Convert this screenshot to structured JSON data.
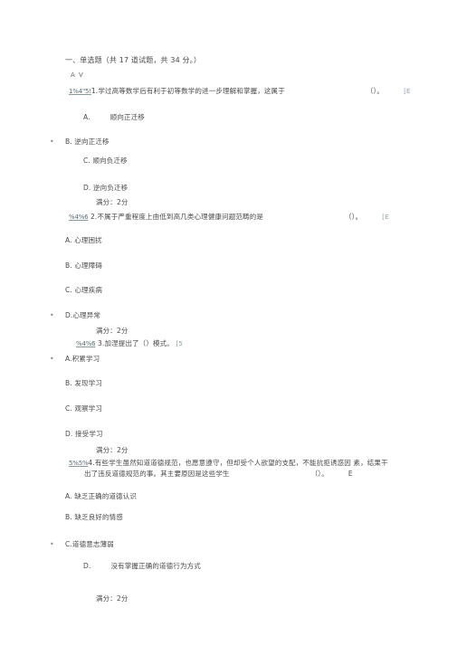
{
  "document": {
    "section_heading": "一、单选题（共 17 道试题，共 34 分。）",
    "small_marker": "A V",
    "full_score_label": "满分：2分",
    "blank_paren": "（）。",
    "cut_marker": "[E"
  },
  "questions": [
    {
      "id_prefix": "1%4\"5!",
      "number": "1.",
      "text": "学过高等数学后有利于初等数学的进一步理解和掌握，这属于",
      "blank": "（）。",
      "tail": "[E",
      "options": [
        {
          "letter": "A.",
          "label": "顺向正迁移",
          "bullet": false,
          "indent": "wide"
        },
        {
          "letter": "B.",
          "label": "逆向正迁移",
          "bullet": true,
          "indent": "narrow"
        },
        {
          "letter": "C.",
          "label": "顺向负迁移",
          "bullet": false,
          "indent": "normal"
        },
        {
          "letter": "D.",
          "label": "逆向负迁移",
          "bullet": false,
          "indent": "normal"
        }
      ],
      "score": "满分：2分"
    },
    {
      "id_prefix": "%4%6",
      "number": "2.",
      "text": "不属于严重程度上由低到高几类心理健康问题范畴的是",
      "blank": "（）。",
      "tail": "[E",
      "options": [
        {
          "letter": "A.",
          "label": "心理困扰",
          "bullet": false,
          "indent": "normal"
        },
        {
          "letter": "B.",
          "label": "心理障碍",
          "bullet": false,
          "indent": "normal"
        },
        {
          "letter": "C.",
          "label": "心理疾病",
          "bullet": false,
          "indent": "normal"
        },
        {
          "letter": "D.",
          "label": "心理异常",
          "bullet": true,
          "indent": "narrow"
        }
      ],
      "score": "满分：2分"
    },
    {
      "id_prefix": "%4%6",
      "number": "3.",
      "text": "加涅提出了（）模式。",
      "blank": "",
      "tail": "[5",
      "options": [
        {
          "letter": "A.",
          "label": "积累学习",
          "bullet": true,
          "indent": "narrow"
        },
        {
          "letter": "B.",
          "label": "发现学习",
          "bullet": false,
          "indent": "normal"
        },
        {
          "letter": "C.",
          "label": "观察学习",
          "bullet": false,
          "indent": "normal"
        },
        {
          "letter": "D.",
          "label": "接受学习",
          "bullet": false,
          "indent": "normal"
        }
      ],
      "score": "满分：2分"
    },
    {
      "id_prefix": "5%5%",
      "number": "4.",
      "text": "有些学生虽然知道道德规范，也愿意遵守，但却受个人欲望的支配，不能抗拒诱惑因 素，结果干",
      "text_line2": "出了违反道德规范的事。其主要原因是这些学生",
      "blank": "（）。",
      "tail": "E",
      "options": [
        {
          "letter": "A.",
          "label": "缺乏正确的道德认识",
          "bullet": false,
          "indent": "normal"
        },
        {
          "letter": "B.",
          "label": "缺乏良好的情感",
          "bullet": false,
          "indent": "normal"
        },
        {
          "letter": "C.",
          "label": "道德意志薄弱",
          "bullet": true,
          "indent": "narrow"
        },
        {
          "letter": "D.",
          "label": "没有掌握正确的道德行为方式",
          "bullet": false,
          "indent": "wide"
        }
      ],
      "score": "满分：2分"
    }
  ]
}
